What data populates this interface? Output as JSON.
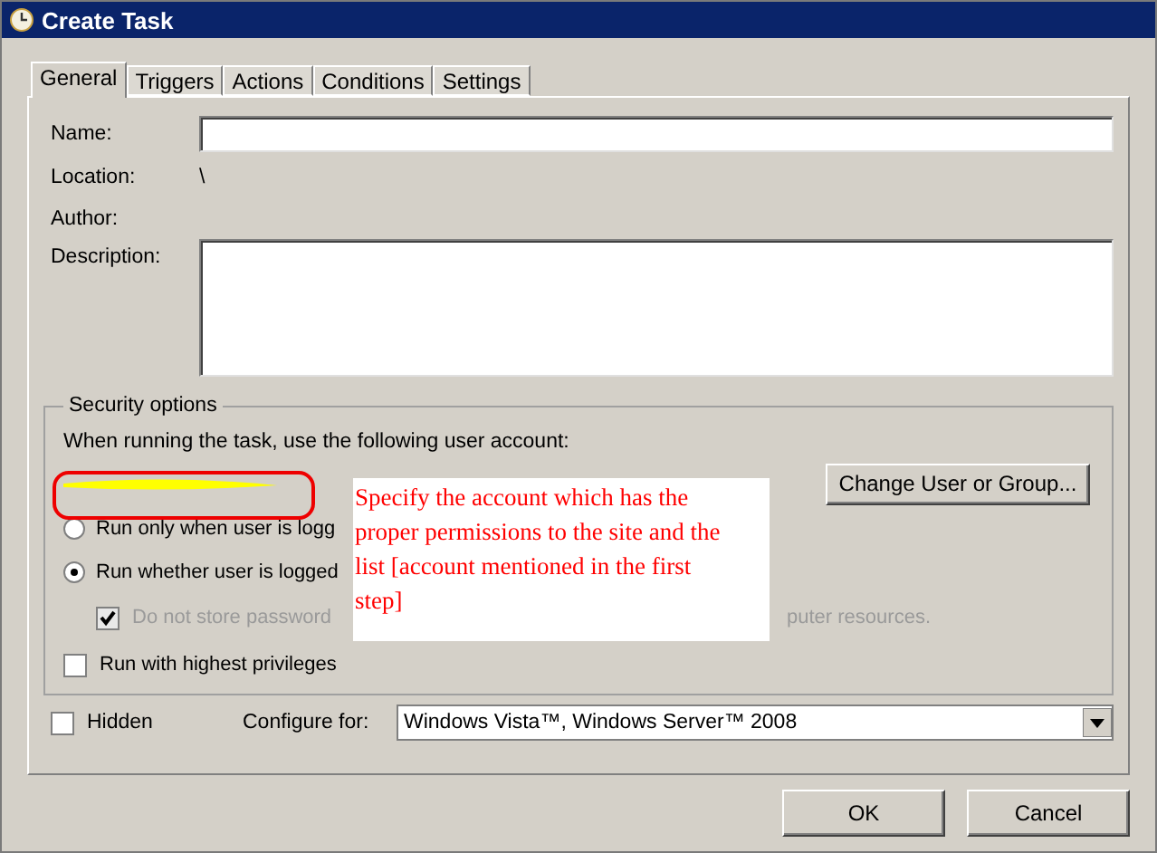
{
  "window": {
    "title": "Create Task"
  },
  "tabs": [
    {
      "label": "General",
      "selected": true
    },
    {
      "label": "Triggers",
      "selected": false
    },
    {
      "label": "Actions",
      "selected": false
    },
    {
      "label": "Conditions",
      "selected": false
    },
    {
      "label": "Settings",
      "selected": false
    }
  ],
  "general": {
    "name_label": "Name:",
    "location_label": "Location:",
    "location_value": "\\",
    "author_label": "Author:",
    "description_label": "Description:"
  },
  "security": {
    "title": "Security options",
    "account_prompt": "When running the task, use the following user account:",
    "change_button": "Change User or Group...",
    "options": [
      {
        "kind": "radio",
        "label": "Run only when user is logg",
        "selected": false
      },
      {
        "kind": "radio",
        "label": "Run whether user is logged",
        "selected": true
      },
      {
        "kind": "subcheck",
        "label": "Do not store password",
        "label_tail": "puter resources.",
        "checked": true,
        "disabled": true
      },
      {
        "kind": "checkbox",
        "label": "Run with highest privileges",
        "checked": false
      }
    ]
  },
  "hidden": {
    "label": "Hidden",
    "checked": false
  },
  "configure": {
    "label": "Configure for:",
    "value": "Windows Vista™, Windows Server™ 2008"
  },
  "buttons": [
    "OK",
    "Cancel"
  ],
  "annotation": {
    "text": "Specify the account which has the proper permissions to the site and the list [account mentioned in the first step]"
  }
}
